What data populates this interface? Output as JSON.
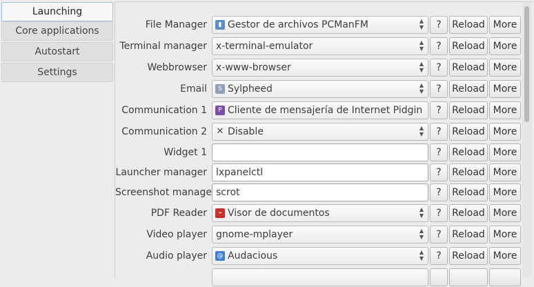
{
  "sidebar": {
    "tabs": [
      {
        "label": "Launching applications"
      },
      {
        "label": "Core applications"
      },
      {
        "label": "Autostart"
      },
      {
        "label": "Settings"
      }
    ]
  },
  "buttons": {
    "help": "?",
    "reload": "Reload",
    "more": "More"
  },
  "rows": [
    {
      "label": "File Manager",
      "type": "combo",
      "value": "Gestor de archivos PCManFM",
      "icon": "folder-icon"
    },
    {
      "label": "Terminal manager",
      "type": "combo",
      "value": "x-terminal-emulator"
    },
    {
      "label": "Webbrowser",
      "type": "combo",
      "value": "x-www-browser"
    },
    {
      "label": "Email",
      "type": "combo",
      "value": "Sylpheed",
      "icon": "sylpheed-icon"
    },
    {
      "label": "Communication 1",
      "type": "combo",
      "value": "Cliente de mensajería de Internet Pidgin",
      "icon": "pidgin-icon"
    },
    {
      "label": "Communication 2",
      "type": "combo",
      "value": "Disable",
      "icon": "disable-x-icon"
    },
    {
      "label": "Widget 1",
      "type": "entry",
      "value": ""
    },
    {
      "label": "Launcher manager",
      "type": "entry",
      "value": "lxpanelctl"
    },
    {
      "label": "Screenshot manager",
      "type": "entry",
      "value": "scrot"
    },
    {
      "label": "PDF Reader",
      "type": "combo",
      "value": "Visor de documentos",
      "icon": "pdf-icon"
    },
    {
      "label": "Video player",
      "type": "combo",
      "value": "gnome-mplayer"
    },
    {
      "label": "Audio player",
      "type": "combo",
      "value": "Audacious",
      "icon": "audacious-icon"
    }
  ]
}
